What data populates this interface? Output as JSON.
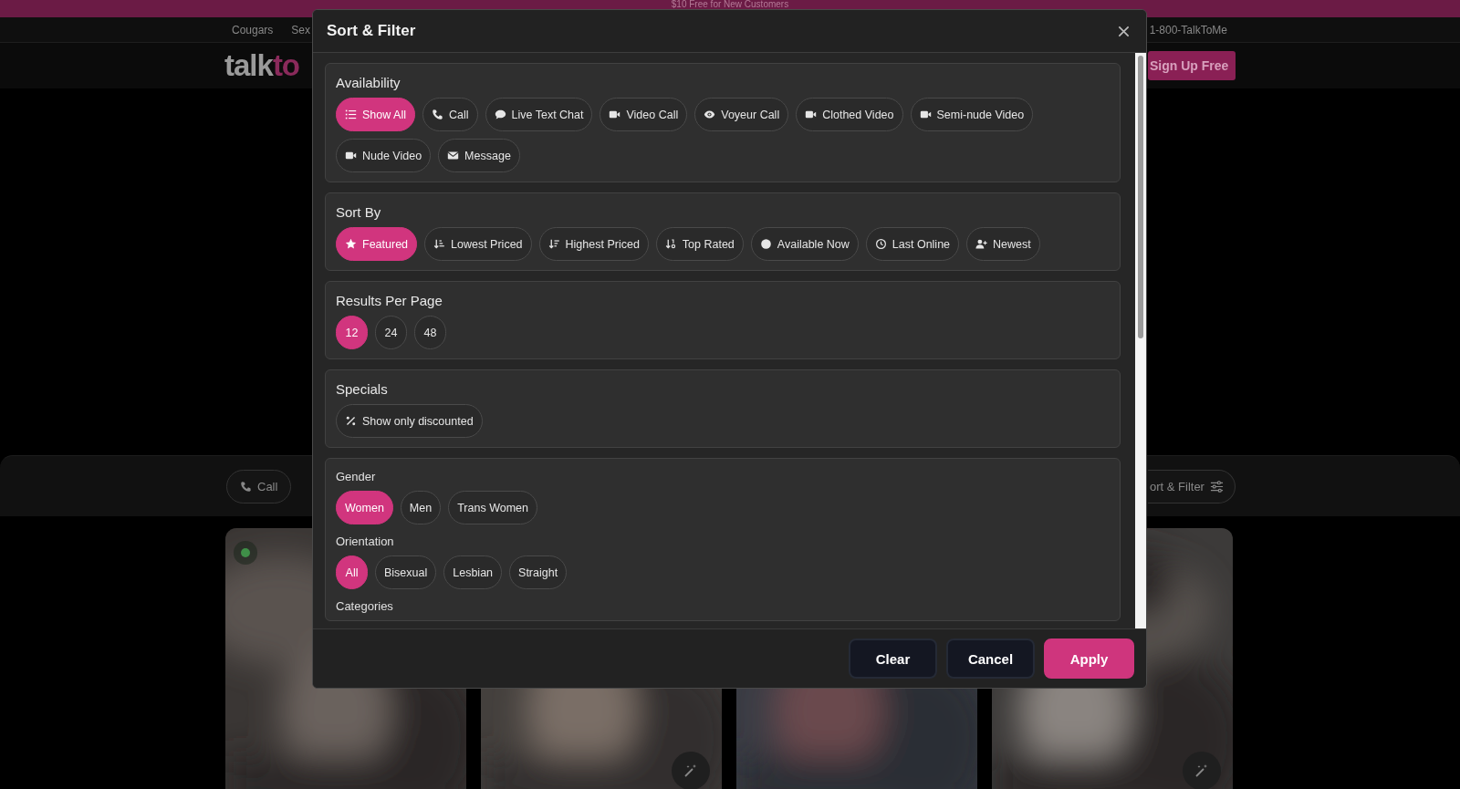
{
  "banner": {
    "text": "$10 Free for New Customers"
  },
  "nav": {
    "links": [
      "Cougars",
      "Sex"
    ],
    "phone": "1-800-TalkToMe"
  },
  "logo": {
    "first": "talk",
    "second": "to"
  },
  "signup_button": "Sign Up Free",
  "filter_bar": {
    "chips": [
      "Call"
    ],
    "sort_button": "ort & Filter"
  },
  "cards": [
    {
      "online": true,
      "wand_button": false
    },
    {
      "online": false,
      "wand_button": true
    },
    {
      "online": false,
      "wand_button": false
    },
    {
      "online": false,
      "wand_button": true
    }
  ],
  "modal": {
    "title": "Sort & Filter",
    "sections": [
      {
        "title": "Availability",
        "options": [
          {
            "label": "Show All",
            "selected": true
          },
          {
            "label": "Call",
            "selected": false
          },
          {
            "label": "Live Text Chat",
            "selected": false
          },
          {
            "label": "Video Call",
            "selected": false
          },
          {
            "label": "Voyeur Call",
            "selected": false
          },
          {
            "label": "Clothed Video",
            "selected": false
          },
          {
            "label": "Semi-nude Video",
            "selected": false
          },
          {
            "label": "Nude Video",
            "selected": false
          },
          {
            "label": "Message",
            "selected": false
          }
        ]
      },
      {
        "title": "Sort By",
        "options": [
          {
            "label": "Featured",
            "selected": true
          },
          {
            "label": "Lowest Priced",
            "selected": false
          },
          {
            "label": "Highest Priced",
            "selected": false
          },
          {
            "label": "Top Rated",
            "selected": false
          },
          {
            "label": "Available Now",
            "selected": false
          },
          {
            "label": "Last Online",
            "selected": false
          },
          {
            "label": "Newest",
            "selected": false
          }
        ]
      },
      {
        "title": "Results Per Page",
        "options": [
          {
            "label": "12",
            "selected": true
          },
          {
            "label": "24",
            "selected": false
          },
          {
            "label": "48",
            "selected": false
          }
        ]
      },
      {
        "title": "Specials",
        "options": [
          {
            "label": "Show only discounted",
            "selected": false
          }
        ]
      }
    ],
    "groups_section": {
      "groups": [
        {
          "title": "Gender",
          "options": [
            {
              "label": "Women",
              "selected": true
            },
            {
              "label": "Men",
              "selected": false
            },
            {
              "label": "Trans Women",
              "selected": false
            }
          ]
        },
        {
          "title": "Orientation",
          "options": [
            {
              "label": "All",
              "selected": true
            },
            {
              "label": "Bisexual",
              "selected": false
            },
            {
              "label": "Lesbian",
              "selected": false
            },
            {
              "label": "Straight",
              "selected": false
            }
          ]
        }
      ],
      "next_heading": "Categories"
    },
    "buttons": [
      {
        "label": "Clear",
        "kind": "secondary"
      },
      {
        "label": "Cancel",
        "kind": "secondary"
      },
      {
        "label": "Apply",
        "kind": "primary"
      }
    ]
  }
}
